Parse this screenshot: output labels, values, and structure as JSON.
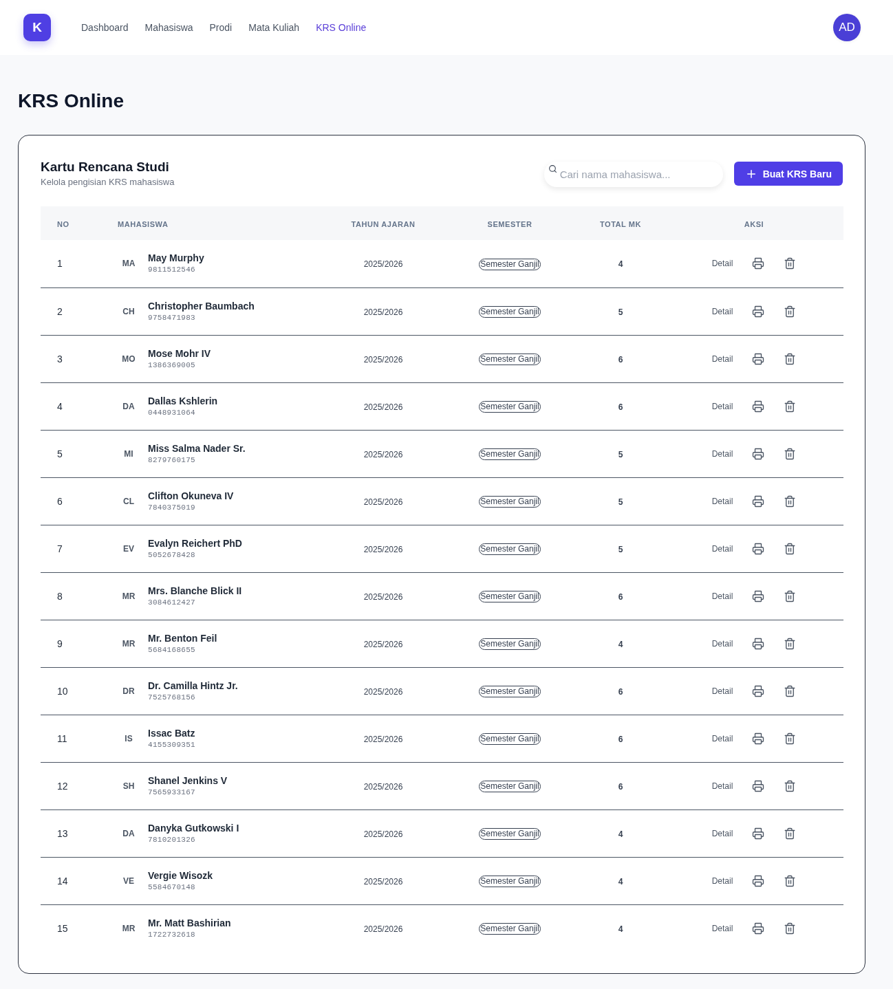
{
  "nav": {
    "logo": "K",
    "items": [
      {
        "label": "Dashboard",
        "selected": false
      },
      {
        "label": "Mahasiswa",
        "selected": false
      },
      {
        "label": "Prodi",
        "selected": false
      },
      {
        "label": "Mata Kuliah",
        "selected": false
      },
      {
        "label": "KRS Online",
        "selected": true
      }
    ],
    "avatar": "AD"
  },
  "page_title": "KRS Online",
  "card": {
    "title": "Kartu Rencana Studi",
    "subtitle": "Kelola pengisian KRS mahasiswa",
    "search": {
      "placeholder": "Cari nama mahasiswa..."
    },
    "create_button": "Buat KRS Baru"
  },
  "table": {
    "columns": [
      "NO",
      "MAHASISWA",
      "TAHUN AJARAN",
      "SEMESTER",
      "TOTAL MK",
      "AKSI"
    ],
    "rows": [
      {
        "no": "1",
        "initials": "MA",
        "name": "May Murphy",
        "nim": "9811512546",
        "year": "2025/2026",
        "semester": "Semester Ganjil",
        "total_mk": "4",
        "detail": "Detail"
      },
      {
        "no": "2",
        "initials": "CH",
        "name": "Christopher Baumbach",
        "nim": "9758471983",
        "year": "2025/2026",
        "semester": "Semester Ganjil",
        "total_mk": "5",
        "detail": "Detail"
      },
      {
        "no": "3",
        "initials": "MO",
        "name": "Mose Mohr IV",
        "nim": "1386369005",
        "year": "2025/2026",
        "semester": "Semester Ganjil",
        "total_mk": "6",
        "detail": "Detail"
      },
      {
        "no": "4",
        "initials": "DA",
        "name": "Dallas Kshlerin",
        "nim": "0448931064",
        "year": "2025/2026",
        "semester": "Semester Ganjil",
        "total_mk": "6",
        "detail": "Detail"
      },
      {
        "no": "5",
        "initials": "MI",
        "name": "Miss Salma Nader Sr.",
        "nim": "8279760175",
        "year": "2025/2026",
        "semester": "Semester Ganjil",
        "total_mk": "5",
        "detail": "Detail"
      },
      {
        "no": "6",
        "initials": "CL",
        "name": "Clifton Okuneva IV",
        "nim": "7840375019",
        "year": "2025/2026",
        "semester": "Semester Ganjil",
        "total_mk": "5",
        "detail": "Detail"
      },
      {
        "no": "7",
        "initials": "EV",
        "name": "Evalyn Reichert PhD",
        "nim": "5052678428",
        "year": "2025/2026",
        "semester": "Semester Ganjil",
        "total_mk": "5",
        "detail": "Detail"
      },
      {
        "no": "8",
        "initials": "MR",
        "name": "Mrs. Blanche Blick II",
        "nim": "3084612427",
        "year": "2025/2026",
        "semester": "Semester Ganjil",
        "total_mk": "6",
        "detail": "Detail"
      },
      {
        "no": "9",
        "initials": "MR",
        "name": "Mr. Benton Feil",
        "nim": "5684168655",
        "year": "2025/2026",
        "semester": "Semester Ganjil",
        "total_mk": "4",
        "detail": "Detail"
      },
      {
        "no": "10",
        "initials": "DR",
        "name": "Dr. Camilla Hintz Jr.",
        "nim": "7525768156",
        "year": "2025/2026",
        "semester": "Semester Ganjil",
        "total_mk": "6",
        "detail": "Detail"
      },
      {
        "no": "11",
        "initials": "IS",
        "name": "Issac Batz",
        "nim": "4155309351",
        "year": "2025/2026",
        "semester": "Semester Ganjil",
        "total_mk": "6",
        "detail": "Detail"
      },
      {
        "no": "12",
        "initials": "SH",
        "name": "Shanel Jenkins V",
        "nim": "7565933167",
        "year": "2025/2026",
        "semester": "Semester Ganjil",
        "total_mk": "6",
        "detail": "Detail"
      },
      {
        "no": "13",
        "initials": "DA",
        "name": "Danyka Gutkowski I",
        "nim": "7810201326",
        "year": "2025/2026",
        "semester": "Semester Ganjil",
        "total_mk": "4",
        "detail": "Detail"
      },
      {
        "no": "14",
        "initials": "VE",
        "name": "Vergie Wisozk",
        "nim": "5584670148",
        "year": "2025/2026",
        "semester": "Semester Ganjil",
        "total_mk": "4",
        "detail": "Detail"
      },
      {
        "no": "15",
        "initials": "MR",
        "name": "Mr. Matt Bashirian",
        "nim": "1722732618",
        "year": "2025/2026",
        "semester": "Semester Ganjil",
        "total_mk": "4",
        "detail": "Detail"
      }
    ]
  }
}
